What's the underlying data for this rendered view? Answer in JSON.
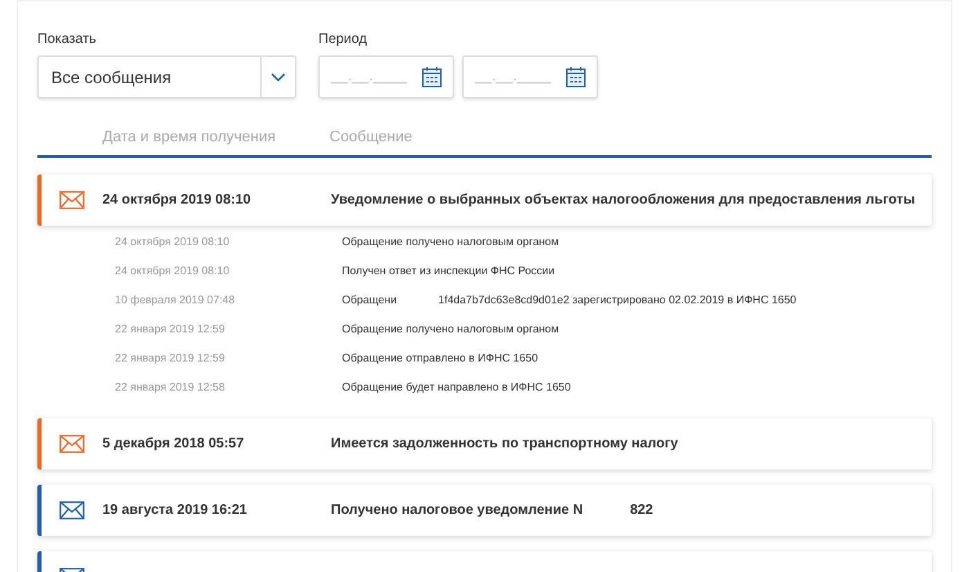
{
  "filters": {
    "show": {
      "label": "Показать",
      "value": "Все сообщения"
    },
    "period": {
      "label": "Период",
      "from": {
        "placeholder": "__.__.____"
      },
      "to": {
        "placeholder": "__.__.____"
      }
    }
  },
  "table": {
    "columns": [
      "Дата и время получения",
      "Сообщение"
    ]
  },
  "messages": [
    {
      "color": "#f26722",
      "date": "24 октября 2019 08:10",
      "parts": [
        "Уведомление о выбранных объектах налогообложения для предоставления льготы"
      ],
      "history": [
        {
          "date": "24 октября 2019 08:10",
          "parts": [
            "Обращение получено налоговым органом"
          ]
        },
        {
          "date": "24 октября 2019 08:10",
          "parts": [
            "Получен ответ из инспекции ФНС России"
          ]
        },
        {
          "date": "10 февраля 2019 07:48",
          "parts": [
            "Обращени",
            "1f4da7b7dc63e8cd9d01e2 зарегистрировано 02.02.2019 в ИФНС 1650"
          ]
        },
        {
          "date": "22 января 2019 12:59",
          "parts": [
            "Обращение получено налоговым органом"
          ]
        },
        {
          "date": "22 января 2019 12:59",
          "parts": [
            "Обращение отправлено в ИФНС 1650"
          ]
        },
        {
          "date": "22 января 2019 12:58",
          "parts": [
            "Обращение будет направлено в ИФНС 1650"
          ]
        }
      ]
    },
    {
      "color": "#f26722",
      "date": "5 декабря 2018 05:57",
      "parts": [
        "Имеется задолженность по транспортному налогу"
      ]
    },
    {
      "color": "#1f5fae",
      "date": "19 августа 2019 16:21",
      "parts": [
        "Получено налоговое уведомление N",
        "822"
      ]
    },
    {
      "color": "#1f5fae"
    }
  ]
}
